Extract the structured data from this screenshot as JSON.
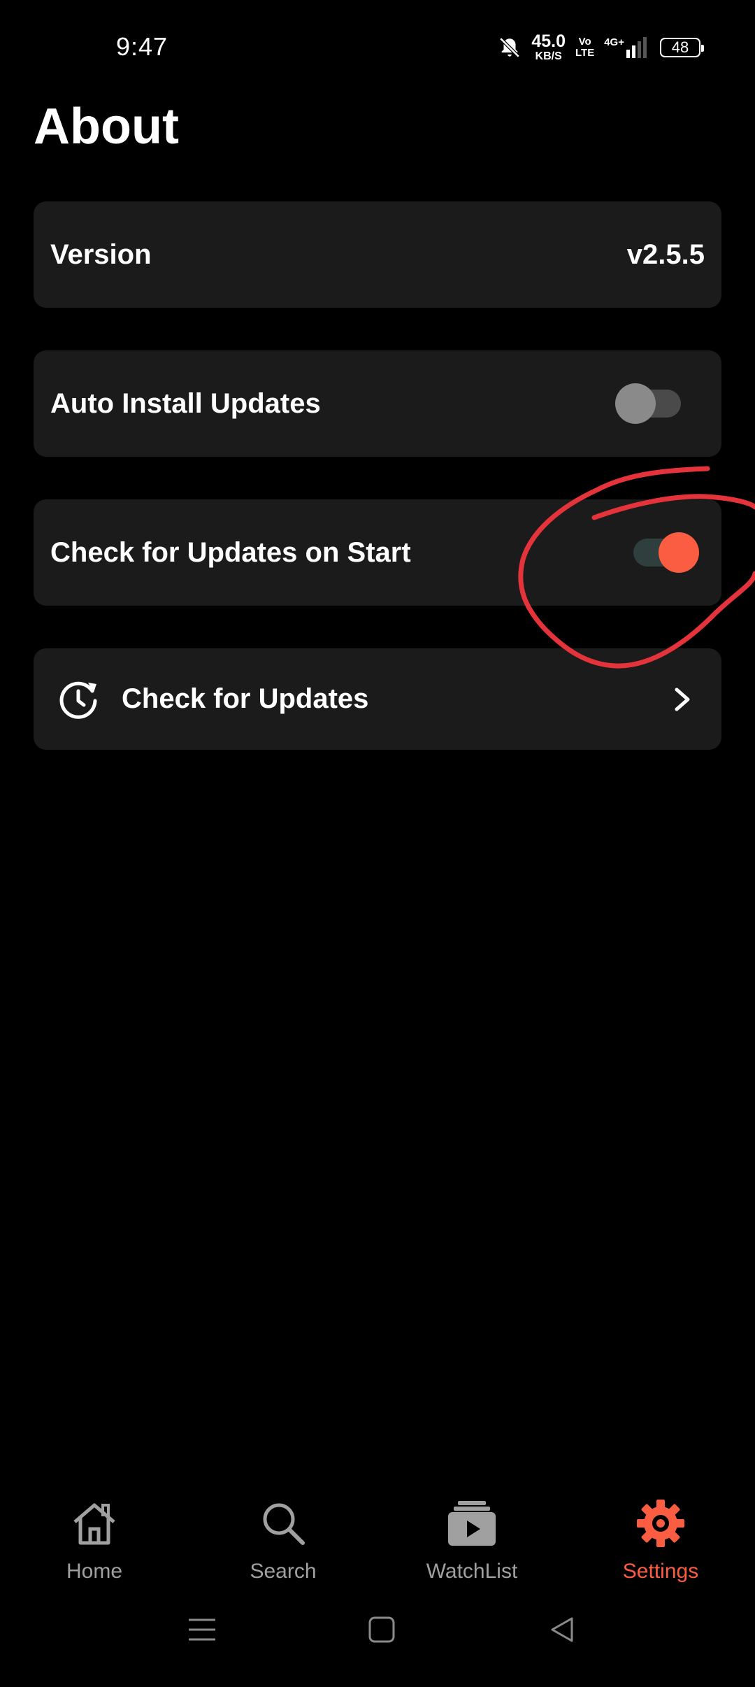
{
  "status_bar": {
    "time": "9:47",
    "net_speed_value": "45.0",
    "net_speed_unit": "KB/S",
    "volte_top": "Vo",
    "volte_bottom": "LTE",
    "network": "4G+",
    "battery": "48"
  },
  "page": {
    "title": "About"
  },
  "settings": {
    "version": {
      "label": "Version",
      "value": "v2.5.5"
    },
    "auto_install": {
      "label": "Auto Install Updates",
      "enabled": false
    },
    "check_on_start": {
      "label": "Check for Updates on Start",
      "enabled": true
    },
    "check_updates": {
      "label": "Check for Updates"
    }
  },
  "bottom_nav": {
    "items": [
      {
        "label": "Home",
        "icon": "home-icon",
        "active": false
      },
      {
        "label": "Search",
        "icon": "search-icon",
        "active": false
      },
      {
        "label": "WatchList",
        "icon": "watchlist-icon",
        "active": false
      },
      {
        "label": "Settings",
        "icon": "gear-icon",
        "active": true
      }
    ]
  },
  "colors": {
    "accent": "#fb5d42",
    "card_bg": "#1b1b1b",
    "annotation": "#e5333b"
  }
}
